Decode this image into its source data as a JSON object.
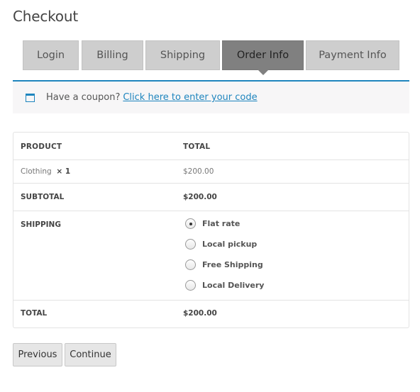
{
  "page": {
    "title": "Checkout"
  },
  "steps": [
    {
      "label": "Login",
      "active": false
    },
    {
      "label": "Billing",
      "active": false
    },
    {
      "label": "Shipping",
      "active": false
    },
    {
      "label": "Order Info",
      "active": true
    },
    {
      "label": "Payment Info",
      "active": false
    }
  ],
  "coupon": {
    "icon": "calendar-icon",
    "text": "Have a coupon?",
    "link_label": "Click here to enter your code",
    "accent_color": "#1e85be"
  },
  "order": {
    "headers": {
      "product": "PRODUCT",
      "total": "TOTAL"
    },
    "item": {
      "name": "Clothing",
      "qty": "× 1",
      "total": "$200.00"
    },
    "subtotal": {
      "label": "SUBTOTAL",
      "value": "$200.00"
    },
    "shipping": {
      "label": "SHIPPING",
      "options": [
        {
          "label": "Flat rate",
          "selected": true
        },
        {
          "label": "Local pickup",
          "selected": false
        },
        {
          "label": "Free Shipping",
          "selected": false
        },
        {
          "label": "Local Delivery",
          "selected": false
        }
      ]
    },
    "total": {
      "label": "TOTAL",
      "value": "$200.00"
    }
  },
  "buttons": {
    "previous": "Previous",
    "continue": "Continue"
  }
}
